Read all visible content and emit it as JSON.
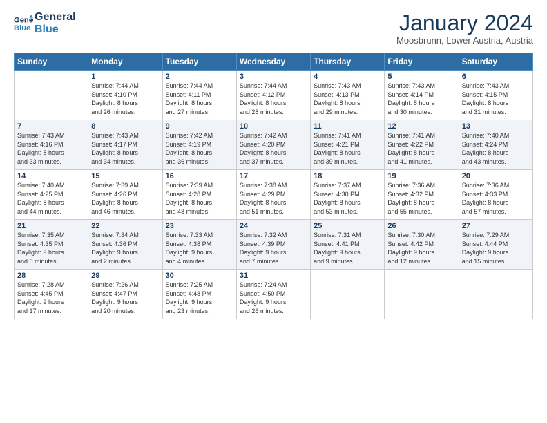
{
  "logo": {
    "line1": "General",
    "line2": "Blue"
  },
  "header": {
    "title": "January 2024",
    "subtitle": "Moosbrunn, Lower Austria, Austria"
  },
  "weekdays": [
    "Sunday",
    "Monday",
    "Tuesday",
    "Wednesday",
    "Thursday",
    "Friday",
    "Saturday"
  ],
  "weeks": [
    [
      {
        "day": "",
        "info": ""
      },
      {
        "day": "1",
        "info": "Sunrise: 7:44 AM\nSunset: 4:10 PM\nDaylight: 8 hours\nand 26 minutes."
      },
      {
        "day": "2",
        "info": "Sunrise: 7:44 AM\nSunset: 4:11 PM\nDaylight: 8 hours\nand 27 minutes."
      },
      {
        "day": "3",
        "info": "Sunrise: 7:44 AM\nSunset: 4:12 PM\nDaylight: 8 hours\nand 28 minutes."
      },
      {
        "day": "4",
        "info": "Sunrise: 7:43 AM\nSunset: 4:13 PM\nDaylight: 8 hours\nand 29 minutes."
      },
      {
        "day": "5",
        "info": "Sunrise: 7:43 AM\nSunset: 4:14 PM\nDaylight: 8 hours\nand 30 minutes."
      },
      {
        "day": "6",
        "info": "Sunrise: 7:43 AM\nSunset: 4:15 PM\nDaylight: 8 hours\nand 31 minutes."
      }
    ],
    [
      {
        "day": "7",
        "info": "Sunrise: 7:43 AM\nSunset: 4:16 PM\nDaylight: 8 hours\nand 33 minutes."
      },
      {
        "day": "8",
        "info": "Sunrise: 7:43 AM\nSunset: 4:17 PM\nDaylight: 8 hours\nand 34 minutes."
      },
      {
        "day": "9",
        "info": "Sunrise: 7:42 AM\nSunset: 4:19 PM\nDaylight: 8 hours\nand 36 minutes."
      },
      {
        "day": "10",
        "info": "Sunrise: 7:42 AM\nSunset: 4:20 PM\nDaylight: 8 hours\nand 37 minutes."
      },
      {
        "day": "11",
        "info": "Sunrise: 7:41 AM\nSunset: 4:21 PM\nDaylight: 8 hours\nand 39 minutes."
      },
      {
        "day": "12",
        "info": "Sunrise: 7:41 AM\nSunset: 4:22 PM\nDaylight: 8 hours\nand 41 minutes."
      },
      {
        "day": "13",
        "info": "Sunrise: 7:40 AM\nSunset: 4:24 PM\nDaylight: 8 hours\nand 43 minutes."
      }
    ],
    [
      {
        "day": "14",
        "info": "Sunrise: 7:40 AM\nSunset: 4:25 PM\nDaylight: 8 hours\nand 44 minutes."
      },
      {
        "day": "15",
        "info": "Sunrise: 7:39 AM\nSunset: 4:26 PM\nDaylight: 8 hours\nand 46 minutes."
      },
      {
        "day": "16",
        "info": "Sunrise: 7:39 AM\nSunset: 4:28 PM\nDaylight: 8 hours\nand 48 minutes."
      },
      {
        "day": "17",
        "info": "Sunrise: 7:38 AM\nSunset: 4:29 PM\nDaylight: 8 hours\nand 51 minutes."
      },
      {
        "day": "18",
        "info": "Sunrise: 7:37 AM\nSunset: 4:30 PM\nDaylight: 8 hours\nand 53 minutes."
      },
      {
        "day": "19",
        "info": "Sunrise: 7:36 AM\nSunset: 4:32 PM\nDaylight: 8 hours\nand 55 minutes."
      },
      {
        "day": "20",
        "info": "Sunrise: 7:36 AM\nSunset: 4:33 PM\nDaylight: 8 hours\nand 57 minutes."
      }
    ],
    [
      {
        "day": "21",
        "info": "Sunrise: 7:35 AM\nSunset: 4:35 PM\nDaylight: 9 hours\nand 0 minutes."
      },
      {
        "day": "22",
        "info": "Sunrise: 7:34 AM\nSunset: 4:36 PM\nDaylight: 9 hours\nand 2 minutes."
      },
      {
        "day": "23",
        "info": "Sunrise: 7:33 AM\nSunset: 4:38 PM\nDaylight: 9 hours\nand 4 minutes."
      },
      {
        "day": "24",
        "info": "Sunrise: 7:32 AM\nSunset: 4:39 PM\nDaylight: 9 hours\nand 7 minutes."
      },
      {
        "day": "25",
        "info": "Sunrise: 7:31 AM\nSunset: 4:41 PM\nDaylight: 9 hours\nand 9 minutes."
      },
      {
        "day": "26",
        "info": "Sunrise: 7:30 AM\nSunset: 4:42 PM\nDaylight: 9 hours\nand 12 minutes."
      },
      {
        "day": "27",
        "info": "Sunrise: 7:29 AM\nSunset: 4:44 PM\nDaylight: 9 hours\nand 15 minutes."
      }
    ],
    [
      {
        "day": "28",
        "info": "Sunrise: 7:28 AM\nSunset: 4:45 PM\nDaylight: 9 hours\nand 17 minutes."
      },
      {
        "day": "29",
        "info": "Sunrise: 7:26 AM\nSunset: 4:47 PM\nDaylight: 9 hours\nand 20 minutes."
      },
      {
        "day": "30",
        "info": "Sunrise: 7:25 AM\nSunset: 4:48 PM\nDaylight: 9 hours\nand 23 minutes."
      },
      {
        "day": "31",
        "info": "Sunrise: 7:24 AM\nSunset: 4:50 PM\nDaylight: 9 hours\nand 26 minutes."
      },
      {
        "day": "",
        "info": ""
      },
      {
        "day": "",
        "info": ""
      },
      {
        "day": "",
        "info": ""
      }
    ]
  ]
}
